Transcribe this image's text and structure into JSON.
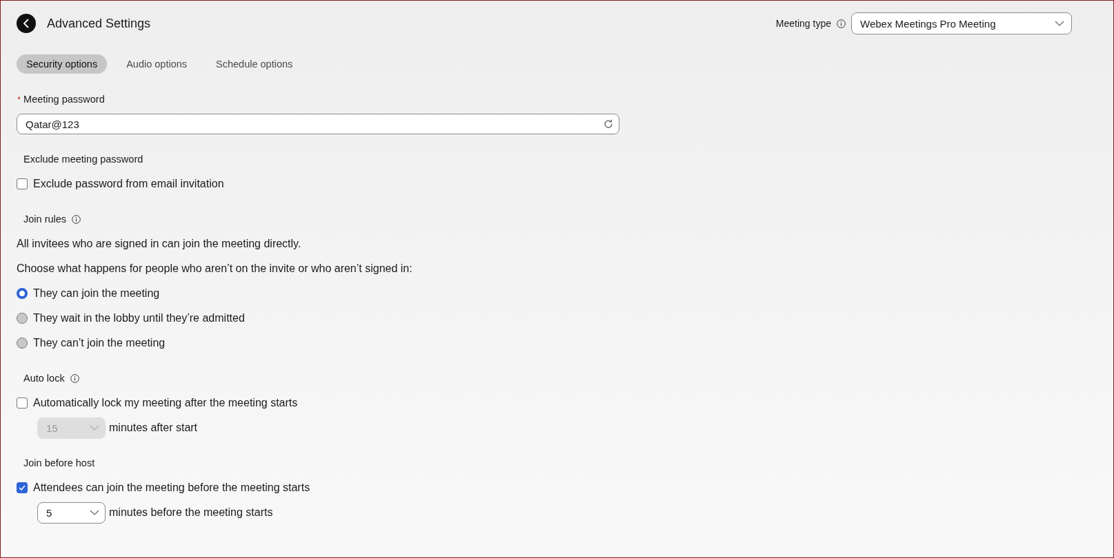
{
  "header": {
    "title": "Advanced Settings"
  },
  "meeting_type": {
    "label": "Meeting type",
    "value": "Webex Meetings Pro Meeting"
  },
  "tabs": [
    {
      "label": "Security options",
      "selected": true
    },
    {
      "label": "Audio options",
      "selected": false
    },
    {
      "label": "Schedule options",
      "selected": false
    }
  ],
  "sections": [
    {
      "heading": "Meeting password",
      "required_marker": "*",
      "info": false,
      "items": [
        {
          "kind": "input",
          "value": "Qatar@123"
        }
      ]
    },
    {
      "heading": "Exclude meeting password",
      "info": false,
      "items": [
        {
          "kind": "checkbox",
          "label": "Exclude password from email invitation",
          "checked": false
        }
      ]
    },
    {
      "heading": "Join rules",
      "info": true,
      "items": [
        {
          "kind": "text",
          "text": "All invitees who are signed in can join the meeting directly."
        },
        {
          "kind": "text",
          "text": "Choose what happens for people who aren’t on the invite or who aren’t signed in:"
        },
        {
          "kind": "radio",
          "label": "They can join the meeting",
          "selected": true
        },
        {
          "kind": "radio",
          "label": "They wait in the lobby until they’re admitted",
          "selected": false
        },
        {
          "kind": "radio",
          "label": "They can’t join the meeting",
          "selected": false
        }
      ]
    },
    {
      "heading": "Auto lock",
      "info": true,
      "items": [
        {
          "kind": "checkbox",
          "label": "Automatically lock my meeting after the meeting starts",
          "checked": false
        },
        {
          "kind": "select",
          "value": "15",
          "suffix": "minutes after start",
          "disabled": true
        }
      ]
    },
    {
      "heading": "Join before host",
      "info": false,
      "items": [
        {
          "kind": "checkbox",
          "label": "Attendees can join the meeting before the meeting starts",
          "checked": true
        },
        {
          "kind": "select",
          "value": "5",
          "suffix": "minutes before the meeting starts",
          "disabled": false
        }
      ]
    }
  ]
}
